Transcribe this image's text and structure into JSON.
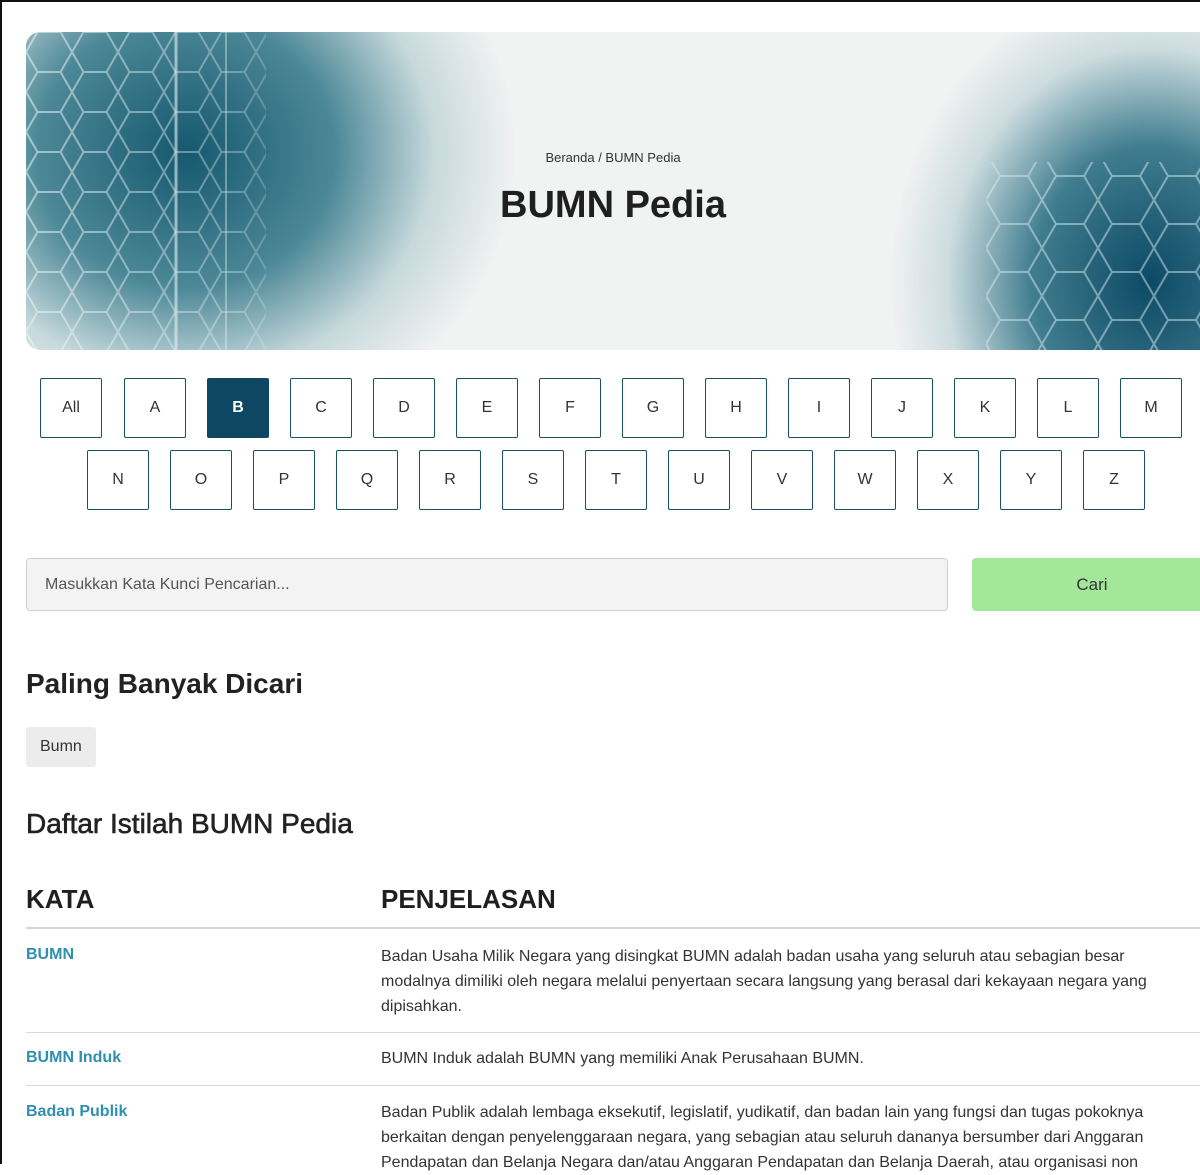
{
  "hero": {
    "breadcrumb": "Beranda / BUMN Pedia",
    "title": "BUMN Pedia"
  },
  "letters": [
    "All",
    "A",
    "B",
    "C",
    "D",
    "E",
    "F",
    "G",
    "H",
    "I",
    "J",
    "K",
    "L",
    "M",
    "N",
    "O",
    "P",
    "Q",
    "R",
    "S",
    "T",
    "U",
    "V",
    "W",
    "X",
    "Y",
    "Z"
  ],
  "active_letter": "B",
  "search": {
    "placeholder": "Masukkan Kata Kunci Pencarian...",
    "button_label": "Cari"
  },
  "popular": {
    "heading": "Paling Banyak Dicari",
    "tags": [
      "Bumn"
    ]
  },
  "glossary": {
    "heading": "Daftar Istilah BUMN Pedia",
    "col_term": "KATA",
    "col_desc": "PENJELASAN",
    "rows": [
      {
        "term": "BUMN",
        "desc": "Badan Usaha Milik Negara yang disingkat BUMN adalah badan usaha yang seluruh atau sebagian besar modalnya dimiliki oleh negara melalui penyertaan secara langsung yang berasal dari kekayaan negara yang dipisahkan."
      },
      {
        "term": "BUMN Induk",
        "desc": "BUMN Induk adalah BUMN yang memiliki Anak Perusahaan BUMN."
      },
      {
        "term": "Badan Publik",
        "desc": "Badan Publik adalah lembaga eksekutif, legislatif, yudikatif, dan badan lain yang fungsi dan tugas pokoknya berkaitan dengan penyelenggaraan negara, yang sebagian atau seluruh dananya bersumber dari Anggaran Pendapatan dan Belanja Negara dan/atau Anggaran Pendapatan dan Belanja Daerah, atau organisasi non"
      }
    ]
  },
  "colors": {
    "accent": "#0d4761",
    "button": "#a3e79a",
    "link": "#2f8fb0"
  }
}
